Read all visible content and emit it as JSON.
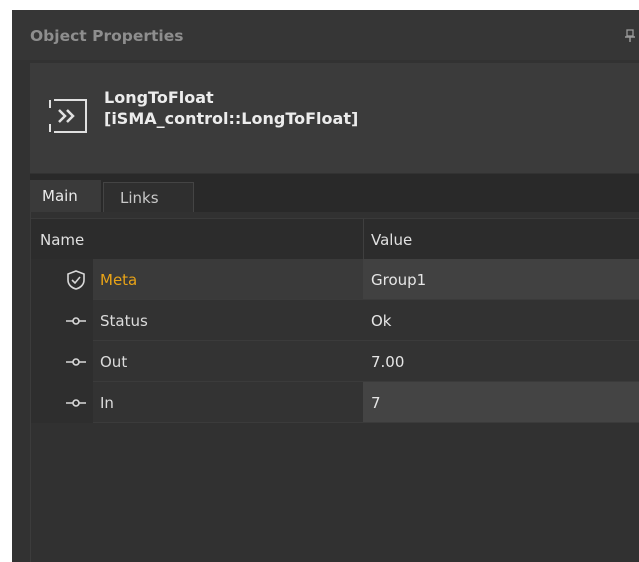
{
  "panel": {
    "title": "Object Properties",
    "pin_icon": "pin-icon"
  },
  "object": {
    "name": "LongToFloat",
    "type": "[iSMA_control::LongToFloat]",
    "icon": "component-icon"
  },
  "tabs": [
    {
      "label": "Main",
      "active": true
    },
    {
      "label": "Links",
      "active": false
    }
  ],
  "grid": {
    "columns": {
      "name": "Name",
      "value": "Value"
    },
    "rows": [
      {
        "name": "Meta",
        "value": "Group1",
        "icon": "shield-icon",
        "highlight": true
      },
      {
        "name": "Status",
        "value": "Ok",
        "icon": "slot-icon"
      },
      {
        "name": "Out",
        "value": "7.00",
        "icon": "slot-icon"
      },
      {
        "name": "In",
        "value": "7",
        "icon": "slot-icon"
      }
    ]
  },
  "colors": {
    "meta_label": "#e8a317",
    "panel_bg": "#323232"
  }
}
